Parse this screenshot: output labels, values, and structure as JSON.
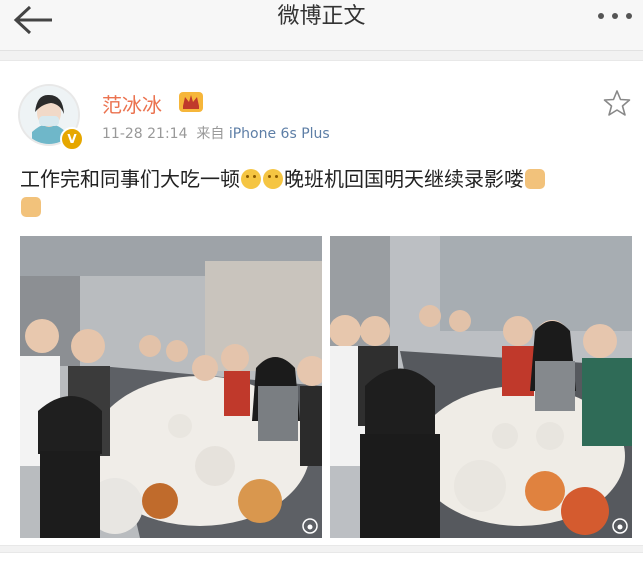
{
  "header": {
    "title": "微博正文",
    "back_icon": "back-arrow-icon",
    "more_icon": "more-dots-icon"
  },
  "post": {
    "author": "范冰冰",
    "verified_icon": "verified-v-icon",
    "verified_label": "V",
    "vip_icon": "vip-crown-icon",
    "timestamp": "11-28 21:14",
    "source_prefix": "来自",
    "source": "iPhone 6s Plus",
    "favorite_icon": "star-outline-icon",
    "text_part1": "工作完和同事们大吃一顿",
    "text_part2": "晚班机回国明天继续录影喽",
    "photos": [
      {
        "kind": "group-dinner-photo",
        "watermark_icon": "weibo-watermark-icon"
      },
      {
        "kind": "group-dinner-photo",
        "watermark_icon": "weibo-watermark-icon"
      }
    ]
  },
  "colors": {
    "accent_name": "#eb7350",
    "source_link": "#5d7ea6",
    "badge": "#e6a700"
  }
}
